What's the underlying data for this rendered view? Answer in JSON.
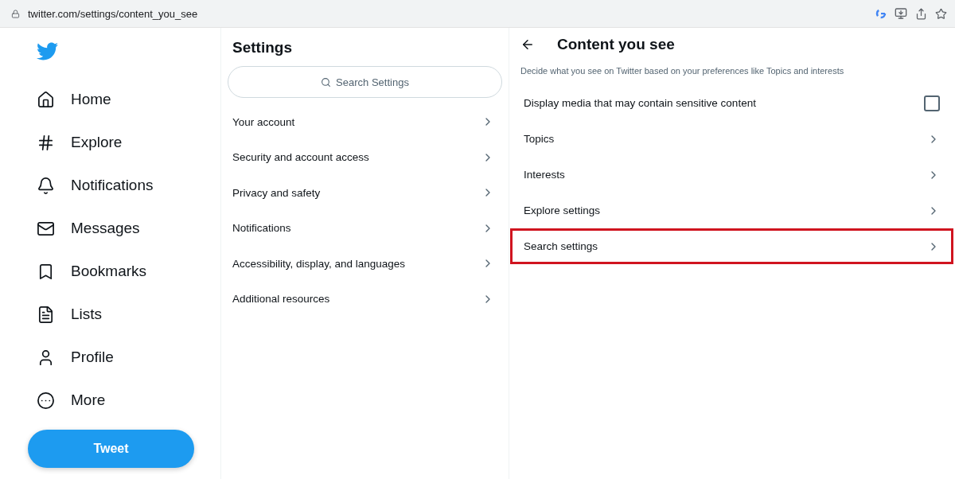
{
  "browser": {
    "url": "twitter.com/settings/content_you_see"
  },
  "nav": {
    "items": [
      {
        "label": "Home"
      },
      {
        "label": "Explore"
      },
      {
        "label": "Notifications"
      },
      {
        "label": "Messages"
      },
      {
        "label": "Bookmarks"
      },
      {
        "label": "Lists"
      },
      {
        "label": "Profile"
      },
      {
        "label": "More"
      }
    ],
    "tweet_button": "Tweet"
  },
  "settings": {
    "title": "Settings",
    "search": {
      "placeholder": "Search Settings"
    },
    "items": [
      {
        "label": "Your account"
      },
      {
        "label": "Security and account access"
      },
      {
        "label": "Privacy and safety"
      },
      {
        "label": "Notifications"
      },
      {
        "label": "Accessibility, display, and languages"
      },
      {
        "label": "Additional resources"
      }
    ]
  },
  "content": {
    "title": "Content you see",
    "description": "Decide what you see on Twitter based on your preferences like Topics and interests",
    "rows": [
      {
        "kind": "checkbox",
        "label": "Display media that may contain sensitive content",
        "checked": false,
        "highlighted": false
      },
      {
        "kind": "link",
        "label": "Topics",
        "highlighted": false
      },
      {
        "kind": "link",
        "label": "Interests",
        "highlighted": false
      },
      {
        "kind": "link",
        "label": "Explore settings",
        "highlighted": false
      },
      {
        "kind": "link",
        "label": "Search settings",
        "highlighted": true
      }
    ]
  }
}
